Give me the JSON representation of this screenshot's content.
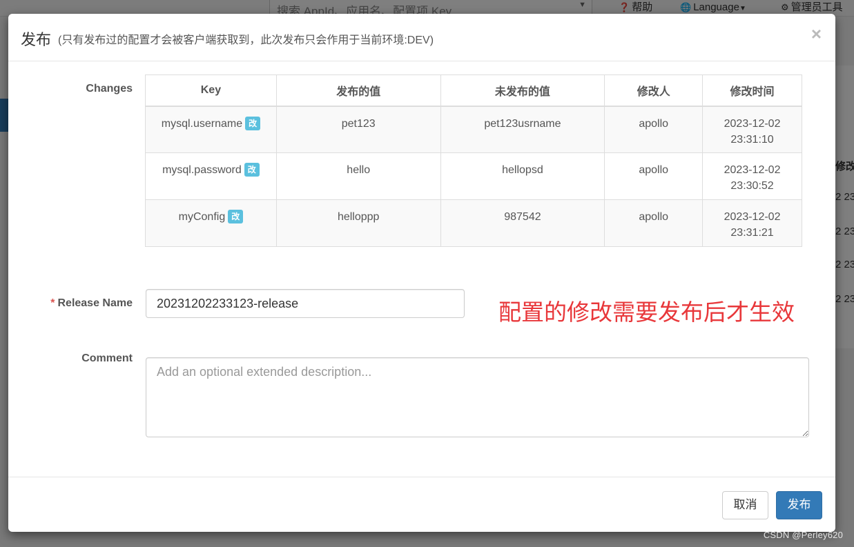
{
  "background": {
    "search_placeholder": "搜索 AppId、应用名、配置项 Key",
    "help_label": "帮助",
    "language_label": "Language",
    "admin_label": "管理员工具",
    "right_header_fragment": "修改",
    "right_time_fragments": [
      "2 23",
      "2 23",
      "2 23",
      "2 23"
    ]
  },
  "modal": {
    "title": "发布",
    "subtitle": "(只有发布过的配置才会被客户端获取到，此次发布只会作用于当前环境:DEV)",
    "close_symbol": "×",
    "changes_label": "Changes",
    "table": {
      "headers": [
        "Key",
        "发布的值",
        "未发布的值",
        "修改人",
        "修改时间"
      ],
      "modified_badge": "改",
      "rows": [
        {
          "key": "mysql.username",
          "released": "pet123",
          "unreleased": "pet123usrname",
          "modifier": "apollo",
          "time": "2023-12-02 23:31:10"
        },
        {
          "key": "mysql.password",
          "released": "hello",
          "unreleased": "hellopsd",
          "modifier": "apollo",
          "time": "2023-12-02 23:30:52"
        },
        {
          "key": "myConfig",
          "released": "helloppp",
          "unreleased": "987542",
          "modifier": "apollo",
          "time": "2023-12-02 23:31:21"
        }
      ]
    },
    "release_name_label": "Release Name",
    "release_name_required": "*",
    "release_name_value": "20231202233123-release",
    "annotation": "配置的修改需要发布后才生效",
    "comment_label": "Comment",
    "comment_placeholder": "Add an optional extended description...",
    "cancel_label": "取消",
    "release_label": "发布"
  },
  "watermark": "CSDN @Perley620",
  "colors": {
    "primary": "#337ab7",
    "badge": "#5bc0de",
    "annotation": "#e8373a",
    "required": "#d9534f"
  }
}
